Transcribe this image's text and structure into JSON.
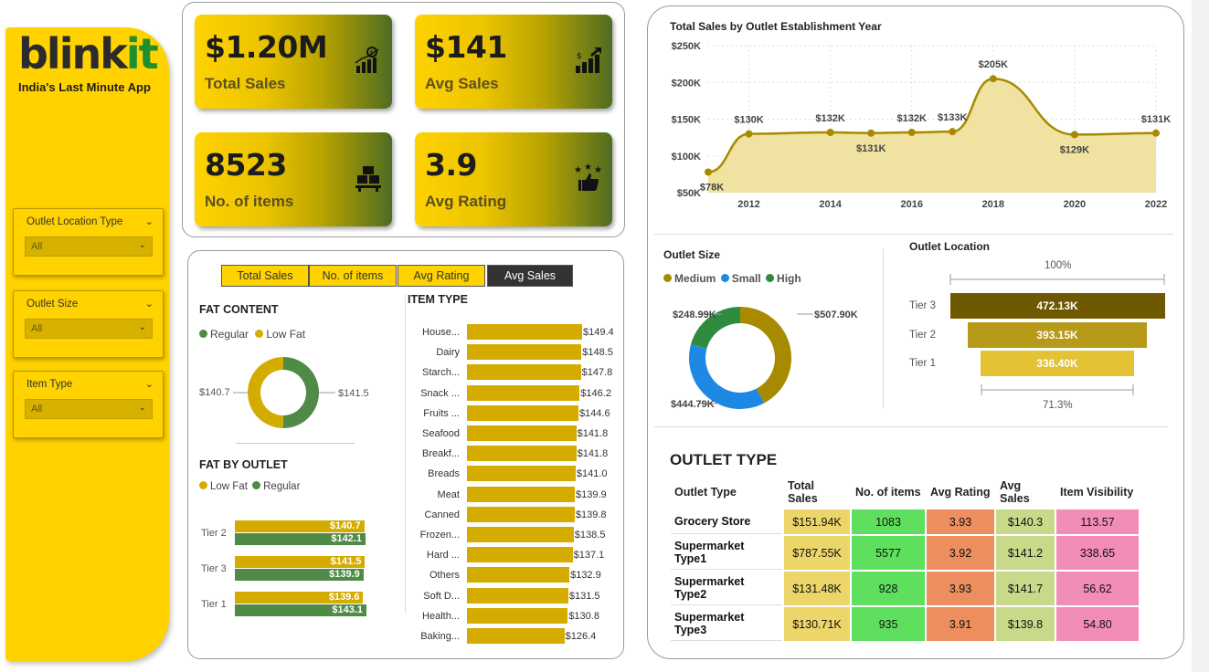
{
  "brand": {
    "logo_part1": "blink",
    "logo_part2": "it",
    "tagline": "India's Last Minute App"
  },
  "filters": [
    {
      "title": "Outlet Location Type",
      "value": "All"
    },
    {
      "title": "Outlet Size",
      "value": "All"
    },
    {
      "title": "Item Type",
      "value": "All"
    }
  ],
  "kpis": [
    {
      "value": "$1.20M",
      "label": "Total Sales",
      "icon": "money-bag-chart-icon"
    },
    {
      "value": "$141",
      "label": "Avg Sales",
      "icon": "money-growth-icon"
    },
    {
      "value": "8523",
      "label": "No. of items",
      "icon": "boxes-icon"
    },
    {
      "value": "3.9",
      "label": "Avg Rating",
      "icon": "stars-thumbs-up-icon"
    }
  ],
  "metric_toggle": {
    "options": [
      "Total Sales",
      "No. of items",
      "Avg Rating",
      "Avg Sales"
    ],
    "selected": "Avg Sales"
  },
  "colors": {
    "accent_yellow": "#ffd200",
    "olive": "#a88a00",
    "regular_green": "#4f8a46",
    "lowfat_gold": "#d4ac00",
    "small_blue": "#1e88e5",
    "high_green": "#2e8b3e"
  },
  "fat_content": {
    "title": "FAT CONTENT",
    "legend": [
      "Regular",
      "Low Fat"
    ],
    "left_label": "$140.7",
    "right_label": "$141.5"
  },
  "fat_by_outlet": {
    "title": "FAT BY OUTLET",
    "legend": [
      "Low Fat",
      "Regular"
    ]
  },
  "item_type_title": "ITEM TYPE",
  "sales_trend_title": "Total Sales by Outlet Establishment Year",
  "outlet_size": {
    "title": "Outlet Size",
    "legend": [
      "Medium",
      "Small",
      "High"
    ]
  },
  "outlet_location": {
    "title": "Outlet Location",
    "top_pct": "100%",
    "bottom_pct": "71.3%"
  },
  "outlet_type": {
    "title": "OUTLET TYPE",
    "columns": [
      "Outlet Type",
      "Total Sales",
      "No. of items",
      "Avg Rating",
      "Avg Sales",
      "Item Visibility"
    ],
    "rows": [
      [
        "Grocery Store",
        "$151.94K",
        "1083",
        "3.93",
        "$140.3",
        "113.57"
      ],
      [
        "Supermarket Type1",
        "$787.55K",
        "5577",
        "3.92",
        "$141.2",
        "338.65"
      ],
      [
        "Supermarket Type2",
        "$131.48K",
        "928",
        "3.93",
        "$141.7",
        "56.62"
      ],
      [
        "Supermarket Type3",
        "$130.71K",
        "935",
        "3.91",
        "$139.8",
        "54.80"
      ]
    ]
  },
  "chart_data": [
    {
      "type": "pie",
      "title": "FAT CONTENT",
      "categories": [
        "Regular",
        "Low Fat"
      ],
      "values": [
        141.5,
        140.7
      ],
      "labels": [
        "$141.5",
        "$140.7"
      ]
    },
    {
      "type": "bar",
      "title": "FAT BY OUTLET",
      "categories": [
        "Tier 2",
        "Tier 3",
        "Tier 1"
      ],
      "series": [
        {
          "name": "Low Fat",
          "values": [
            140.7,
            141.5,
            139.6
          ],
          "labels": [
            "$140.7",
            "$141.5",
            "$139.6"
          ]
        },
        {
          "name": "Regular",
          "values": [
            142.1,
            139.9,
            143.1
          ],
          "labels": [
            "$142.1",
            "$139.9",
            "$143.1"
          ]
        }
      ]
    },
    {
      "type": "bar",
      "title": "ITEM TYPE",
      "categories": [
        "House...",
        "Dairy",
        "Starch...",
        "Snack ...",
        "Fruits ...",
        "Seafood",
        "Breakf...",
        "Breads",
        "Meat",
        "Canned",
        "Frozen...",
        "Hard ...",
        "Others",
        "Soft D...",
        "Health...",
        "Baking..."
      ],
      "values": [
        149.4,
        148.5,
        147.8,
        146.2,
        144.6,
        141.8,
        141.8,
        141.0,
        139.9,
        139.8,
        138.5,
        137.1,
        132.9,
        131.5,
        130.8,
        126.4
      ],
      "labels": [
        "$149.4",
        "$148.5",
        "$147.8",
        "$146.2",
        "$144.6",
        "$141.8",
        "$141.8",
        "$141.0",
        "$139.9",
        "$139.8",
        "$138.5",
        "$137.1",
        "$132.9",
        "$131.5",
        "$130.8",
        "$126.4"
      ]
    },
    {
      "type": "area",
      "title": "Total Sales by Outlet Establishment Year",
      "x": [
        2011,
        2012,
        2014,
        2015,
        2016,
        2017,
        2018,
        2020,
        2022
      ],
      "values": [
        78,
        130,
        132,
        131,
        132,
        133,
        205,
        129,
        131
      ],
      "labels": [
        "$78K",
        "$130K",
        "$132K",
        "$131K",
        "$132K",
        "$133K",
        "$205K",
        "$129K",
        "$131K"
      ],
      "label_pos": [
        "below",
        "above",
        "above",
        "below",
        "above",
        "above",
        "above",
        "below",
        "above"
      ],
      "xticks": [
        "2012",
        "2014",
        "2016",
        "2018",
        "2020",
        "2022"
      ],
      "yticks": [
        "$50K",
        "$100K",
        "$150K",
        "$200K",
        "$250K"
      ],
      "ylim": [
        50,
        250
      ],
      "grid": true
    },
    {
      "type": "pie",
      "title": "Outlet Size",
      "categories": [
        "Medium",
        "Small",
        "High"
      ],
      "values": [
        507.9,
        444.79,
        248.99
      ],
      "labels": [
        "$507.90K",
        "$444.79K",
        "$248.99K"
      ]
    },
    {
      "type": "bar",
      "title": "Outlet Location",
      "categories": [
        "Tier 3",
        "Tier 2",
        "Tier 1"
      ],
      "values": [
        472.13,
        393.15,
        336.4
      ],
      "labels": [
        "472.13K",
        "393.15K",
        "336.40K"
      ]
    }
  ]
}
